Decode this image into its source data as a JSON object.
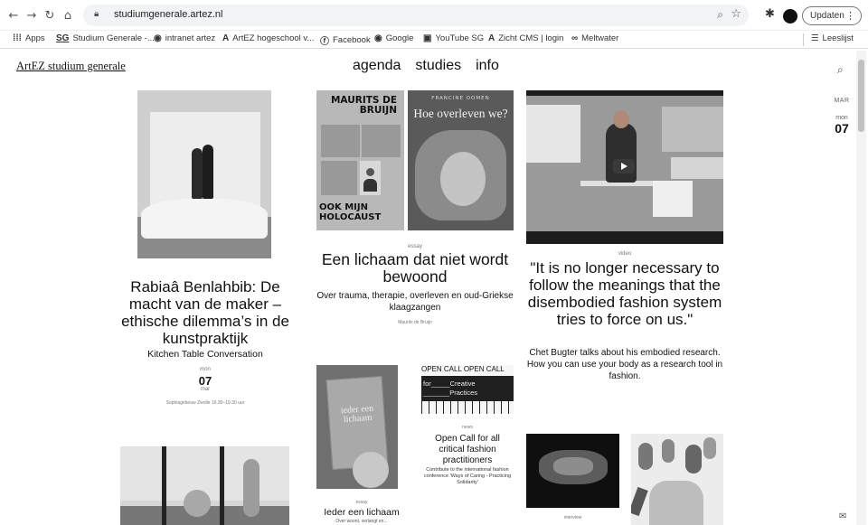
{
  "browser": {
    "url": "studiumgenerale.artez.nl",
    "update_label": "Updaten",
    "bookmarks": [
      {
        "icon": "apps-grid-icon",
        "label": "Apps"
      },
      {
        "icon": "sg-logo-icon",
        "label": "Studium Generale -..."
      },
      {
        "icon": "globe-icon",
        "label": "intranet artez"
      },
      {
        "icon": "a-logo-icon",
        "label": "ArtEZ hogeschool v..."
      },
      {
        "icon": "facebook-icon",
        "label": "Facebook"
      },
      {
        "icon": "globe-icon",
        "label": "Google"
      },
      {
        "icon": "youtube-icon",
        "label": "YouTube SG"
      },
      {
        "icon": "a-logo-icon",
        "label": "Zicht CMS | login"
      },
      {
        "icon": "link-icon",
        "label": "Meltwater"
      }
    ],
    "reading_list": "Leeslijst"
  },
  "site": {
    "logo": "ArtEZ studium generale",
    "nav": [
      "agenda",
      "studies",
      "info"
    ],
    "date_rail": {
      "month": "MAR",
      "dayname": "mon",
      "day": "07"
    }
  },
  "cards": {
    "c1": {
      "title": "Rabiaâ Benlahbib: De macht van de maker – ethische dilemma’s in de kunstpraktijk",
      "subtitle": "Kitchen Table Conversation",
      "dayname": "mon",
      "day": "07",
      "month": "mar",
      "location": "Sophiagebouw Zwolle 16.30–19.30 uur"
    },
    "c2": {
      "cover1_title": "MAURITS DE BRUIJN",
      "cover1_bottom": "OOK MIJN HOLOCAUST",
      "cover2_author": "FRANCINE OOMEN",
      "cover2_title": "Hoe overleven we?",
      "kicker": "essay",
      "title": "Een lichaam dat niet wordt bewoond",
      "subtitle": "Over trauma, therapie, overleven en oud-Griekse klaagzangen",
      "author": "Maurits de Bruijn"
    },
    "c3": {
      "kicker": "video",
      "title": "\"It is no longer necessary to follow the meanings that the disembodied fashion system tries to force on us.\"",
      "subtitle": "Chet Bugter talks about his embodied research. How you can use your body as a research tool in fashion."
    },
    "c4": {
      "book_text": "ieder een lichaam",
      "kicker": "essay",
      "title": "Ieder een lichaam",
      "subtitle": "Over woont, verlangt en..."
    },
    "c5": {
      "img_row": "OPEN CALL OPEN CALL",
      "img_band": "for_____Creative _______Practices",
      "kicker": "news",
      "title": "Open Call for all critical fashion practitioners",
      "subtitle": "Contribute to the international fashion conference 'Ways of Caring - Practicing Solidarity'"
    },
    "c6": {
      "kicker": "interview"
    }
  }
}
